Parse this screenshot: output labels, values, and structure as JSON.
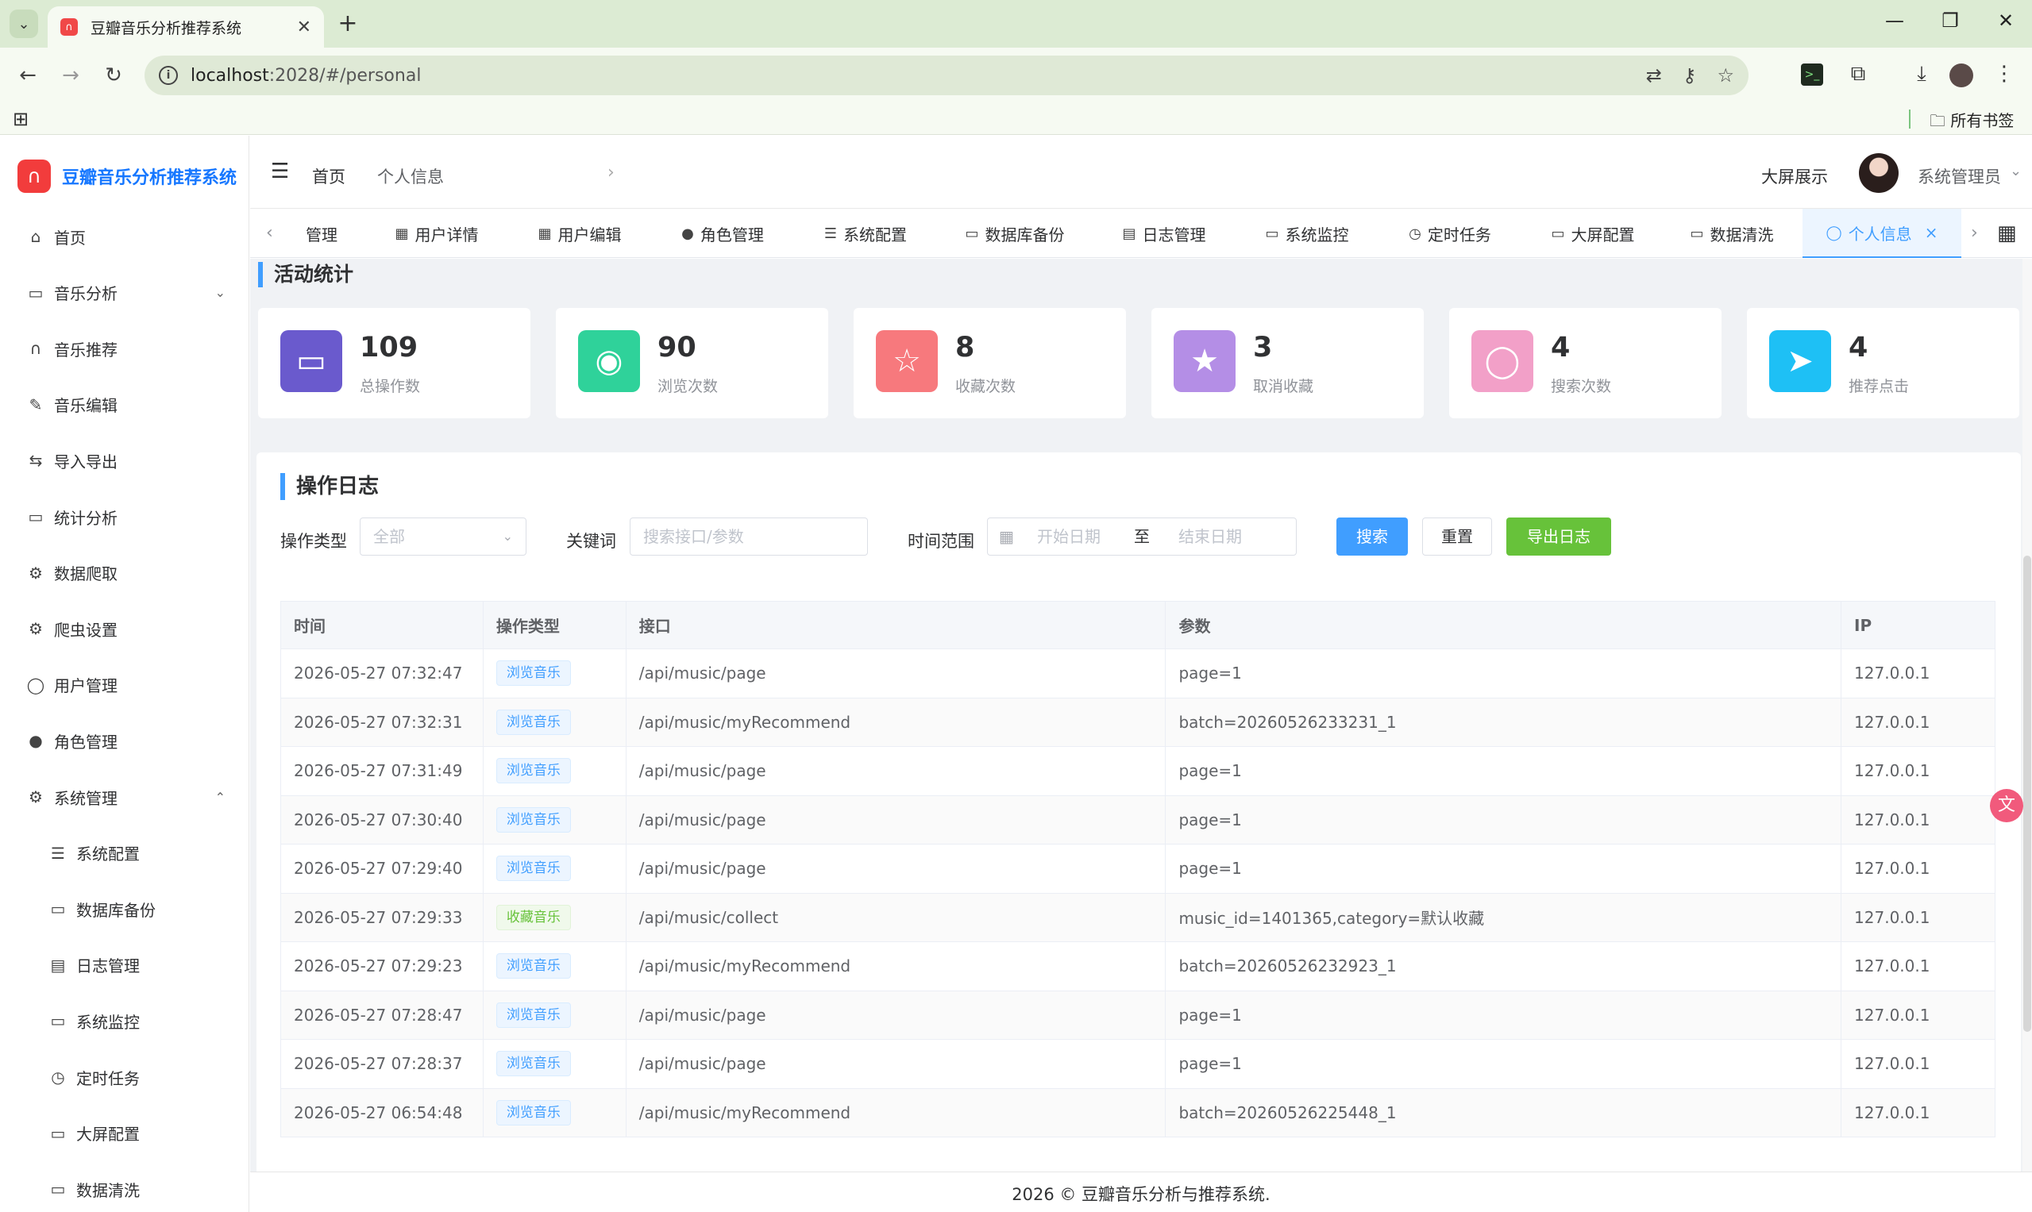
{
  "browser": {
    "menu_icon": "chevron-down-icon",
    "tab_title": "豆瓣音乐分析推荐系统",
    "tab_close": "✕",
    "new_tab": "+",
    "url_host": "localhost",
    "url_rest": ":2028/#/personal",
    "bookmarks_all": "所有书签"
  },
  "sidebar": {
    "brand": "豆瓣音乐分析推荐系统",
    "items": [
      {
        "label": "首页",
        "icon": "home-icon"
      },
      {
        "label": "音乐分析",
        "icon": "chart-board-icon",
        "arrow": "expand"
      },
      {
        "label": "音乐推荐",
        "icon": "headphones-icon"
      },
      {
        "label": "音乐编辑",
        "icon": "edit-icon"
      },
      {
        "label": "导入导出",
        "icon": "transfer-icon"
      },
      {
        "label": "统计分析",
        "icon": "chart-board-icon"
      },
      {
        "label": "数据爬取",
        "icon": "crawler-icon"
      },
      {
        "label": "爬虫设置",
        "icon": "gear-icon"
      },
      {
        "label": "用户管理",
        "icon": "user-icon"
      },
      {
        "label": "角色管理",
        "icon": "role-icon"
      },
      {
        "label": "系统管理",
        "icon": "gear-icon",
        "arrow": "collapse"
      },
      {
        "label": "系统配置",
        "icon": "sliders-icon"
      },
      {
        "label": "数据库备份",
        "icon": "folder-icon"
      },
      {
        "label": "日志管理",
        "icon": "document-icon"
      },
      {
        "label": "系统监控",
        "icon": "monitor-icon"
      },
      {
        "label": "定时任务",
        "icon": "timer-icon"
      },
      {
        "label": "大屏配置",
        "icon": "screen-icon"
      },
      {
        "label": "数据清洗",
        "icon": "clean-icon"
      }
    ]
  },
  "header": {
    "breadcrumb": [
      "首页",
      "个人信息"
    ],
    "bigscreen": "大屏展示",
    "user_name": "系统管理员"
  },
  "tags": [
    {
      "label": "管理",
      "icon": ""
    },
    {
      "label": "用户详情",
      "icon": "grid-icon"
    },
    {
      "label": "用户编辑",
      "icon": "grid-icon"
    },
    {
      "label": "角色管理",
      "icon": "role-icon"
    },
    {
      "label": "系统配置",
      "icon": "sliders-icon"
    },
    {
      "label": "数据库备份",
      "icon": "folder-icon"
    },
    {
      "label": "日志管理",
      "icon": "document-icon"
    },
    {
      "label": "系统监控",
      "icon": "monitor-icon"
    },
    {
      "label": "定时任务",
      "icon": "timer-icon"
    },
    {
      "label": "大屏配置",
      "icon": "screen-icon"
    },
    {
      "label": "数据清洗",
      "icon": "clean-icon"
    },
    {
      "label": "个人信息",
      "icon": "user-icon",
      "active": true
    }
  ],
  "stats": {
    "title": "活动统计",
    "cards": [
      {
        "value": "109",
        "label": "总操作数",
        "icon": "chart-board-icon",
        "color": "#6a5acd"
      },
      {
        "value": "90",
        "label": "浏览次数",
        "icon": "eye-icon",
        "color": "#2fd29a"
      },
      {
        "value": "8",
        "label": "收藏次数",
        "icon": "star-outline-icon",
        "color": "#f7797d"
      },
      {
        "value": "3",
        "label": "取消收藏",
        "icon": "star-filled-icon",
        "color": "#b48ee6"
      },
      {
        "value": "4",
        "label": "搜索次数",
        "icon": "search-icon",
        "color": "#f2a0c8"
      },
      {
        "value": "4",
        "label": "推荐点击",
        "icon": "send-icon",
        "color": "#1ec0f5"
      }
    ]
  },
  "log": {
    "title": "操作日志",
    "filters": {
      "type_label": "操作类型",
      "type_value": "全部",
      "keyword_label": "关键词",
      "keyword_placeholder": "搜索接口/参数",
      "range_label": "时间范围",
      "start_placeholder": "开始日期",
      "range_to": "至",
      "end_placeholder": "结束日期"
    },
    "buttons": {
      "search": "搜索",
      "reset": "重置",
      "export": "导出日志"
    },
    "columns": [
      "时间",
      "操作类型",
      "接口",
      "参数",
      "IP"
    ],
    "rows": [
      {
        "time": "2026-05-27 07:32:47",
        "type": "浏览音乐",
        "api": "/api/music/page",
        "params": "page=1",
        "ip": "127.0.0.1"
      },
      {
        "time": "2026-05-27 07:32:31",
        "type": "浏览音乐",
        "api": "/api/music/myRecommend",
        "params": "batch=20260526233231_1",
        "ip": "127.0.0.1"
      },
      {
        "time": "2026-05-27 07:31:49",
        "type": "浏览音乐",
        "api": "/api/music/page",
        "params": "page=1",
        "ip": "127.0.0.1"
      },
      {
        "time": "2026-05-27 07:30:40",
        "type": "浏览音乐",
        "api": "/api/music/page",
        "params": "page=1",
        "ip": "127.0.0.1"
      },
      {
        "time": "2026-05-27 07:29:40",
        "type": "浏览音乐",
        "api": "/api/music/page",
        "params": "page=1",
        "ip": "127.0.0.1"
      },
      {
        "time": "2026-05-27 07:29:33",
        "type": "收藏音乐",
        "api": "/api/music/collect",
        "params": "music_id=1401365,category=默认收藏",
        "ip": "127.0.0.1"
      },
      {
        "time": "2026-05-27 07:29:23",
        "type": "浏览音乐",
        "api": "/api/music/myRecommend",
        "params": "batch=20260526232923_1",
        "ip": "127.0.0.1"
      },
      {
        "time": "2026-05-27 07:28:47",
        "type": "浏览音乐",
        "api": "/api/music/page",
        "params": "page=1",
        "ip": "127.0.0.1"
      },
      {
        "time": "2026-05-27 07:28:37",
        "type": "浏览音乐",
        "api": "/api/music/page",
        "params": "page=1",
        "ip": "127.0.0.1"
      },
      {
        "time": "2026-05-27 06:54:48",
        "type": "浏览音乐",
        "api": "/api/music/myRecommend",
        "params": "batch=20260526225448_1",
        "ip": "127.0.0.1"
      }
    ]
  },
  "footer": "2026 © 豆瓣音乐分析与推荐系统."
}
